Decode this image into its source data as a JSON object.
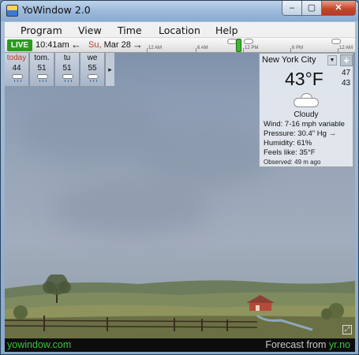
{
  "window": {
    "title": "YoWindow 2.0",
    "close_glyph": "✕",
    "max_glyph": "▢",
    "min_glyph": "–"
  },
  "menu": [
    "Program",
    "View",
    "Time",
    "Location",
    "Help"
  ],
  "timeline": {
    "live": "LIVE",
    "time": "10:41am",
    "prev_glyph": "←",
    "next_glyph": "→",
    "date_dow": "Su,",
    "date": " Mar 28",
    "hours": [
      "12 AM",
      "6 AM",
      "12 PM",
      "6 PM",
      "12 AM"
    ]
  },
  "daily": [
    {
      "day": "today",
      "temp": "44",
      "icon": "rain-cloud-icon"
    },
    {
      "day": "tom.",
      "temp": "51",
      "icon": "rain-cloud-icon"
    },
    {
      "day": "tu",
      "temp": "51",
      "icon": "rain-cloud-icon"
    },
    {
      "day": "we",
      "temp": "55",
      "icon": "rain-cloud-icon"
    }
  ],
  "daily_more": "▸",
  "current": {
    "city": "New York City",
    "city_dropdown": "▼",
    "add": "+",
    "temp": "43°F",
    "high": "47",
    "low": "43",
    "condition": "Cloudy",
    "wind": "Wind:  7-16 mph variable",
    "pressure": "Pressure:  30.4\" Hg  →",
    "humidity": "Humidity:  61%",
    "feels": "Feels like:  35°F",
    "observed": "Observed:  49 m ago"
  },
  "fullscreen_glyph": "⤢",
  "footer": {
    "left": "yowindow.com",
    "right_prefix": "Forecast from ",
    "right_link": "yr.no"
  },
  "colors": {
    "live": "#2a9a1f",
    "footer_link": "#39c53a",
    "accent_red": "#c0392b"
  }
}
